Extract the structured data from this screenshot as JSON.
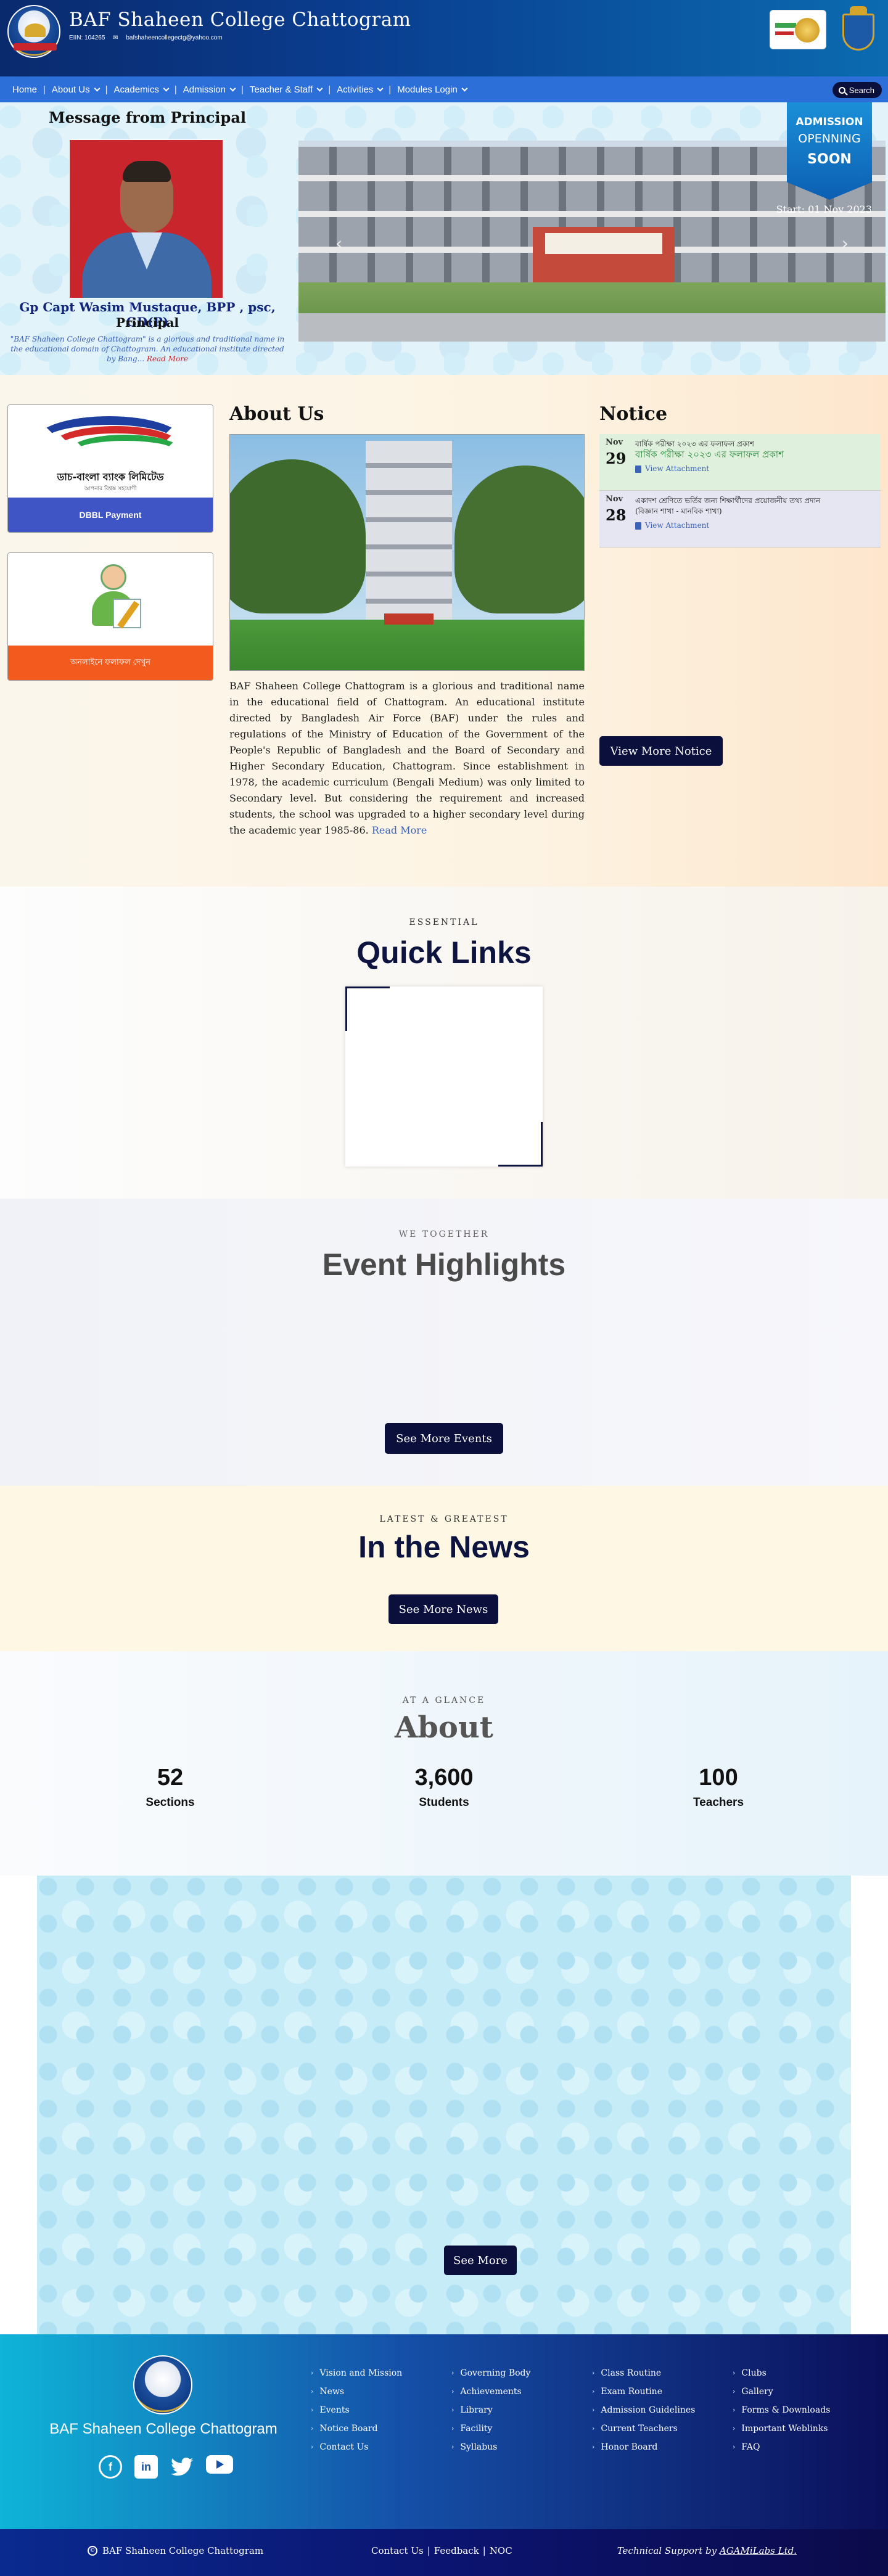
{
  "header": {
    "title": "BAF Shaheen College Chattogram",
    "eiin": "EIIN: 104265",
    "email": "bafshaheencollegectg@yahoo.com"
  },
  "nav": {
    "items": [
      {
        "label": "Home",
        "dropdown": false
      },
      {
        "label": "About Us",
        "dropdown": true
      },
      {
        "label": "Academics",
        "dropdown": true
      },
      {
        "label": "Admission",
        "dropdown": true
      },
      {
        "label": "Teacher & Staff",
        "dropdown": true
      },
      {
        "label": "Activities",
        "dropdown": true
      },
      {
        "label": "Modules Login",
        "dropdown": true
      }
    ],
    "search_label": "Search"
  },
  "principal": {
    "heading": "Message from Principal",
    "name": "Gp Capt Wasim Mustaque, BPP , psc, GD(P)",
    "role": "Principal",
    "quote": "\"BAF Shaheen College Chattogram\" is a glorious and traditional name in the educational domain of Chattogram. An educational institute directed by Bang...",
    "read_more": "Read More"
  },
  "slider": {
    "caption": "Start: 01 Nov 2023",
    "badge_line1": "ADMISSION",
    "badge_line2": "OPENNING",
    "badge_line3": "SOON"
  },
  "cards": {
    "dbbl_logo_text": "ডাচ-বাংলা ব্যাংক লিমিটেড",
    "dbbl_logo_sub": "আপনার বিশ্বস্ত সহযোগী",
    "dbbl_caption": "DBBL Payment",
    "result_caption": "অনলাইনে ফলাফল দেখুন"
  },
  "about": {
    "heading": "About Us",
    "text": "BAF Shaheen College Chattogram is a glorious and traditional name in the educational field of Chattogram. An educational institute directed by Bangladesh Air Force (BAF) under the rules and regulations of the Ministry of Education of the Government of the People's Republic of Bangladesh and the Board of Secondary and Higher Secondary Education, Chattogram. Since establishment in 1978, the academic curriculum (Bengali Medium) was only limited to Secondary level. But considering the requirement and increased students, the school was upgraded to a higher secondary level during the academic year 1985-86.",
    "read_more": "Read More"
  },
  "notice": {
    "heading": "Notice",
    "items": [
      {
        "month": "Nov",
        "day": "29",
        "line1": "বার্ষিক পরীক্ষা ২০২৩ এর ফলাফল প্রকাশ",
        "line2": "বার্ষিক পরীক্ষা ২০২৩ এর ফলাফল প্রকাশ",
        "attach": "View Attachment"
      },
      {
        "month": "Nov",
        "day": "28",
        "line1": "একাদশ শ্রেণিতে ভর্তির জন্য শিক্ষার্থীদের প্রয়োজনীয় তথ্য প্রদান",
        "line2": "(বিজ্ঞান শাখা - মানবিক শাখা)",
        "attach": "View Attachment"
      }
    ],
    "view_more": "View More Notice"
  },
  "quick_links": {
    "eyebrow": "ESSENTIAL",
    "title": "Quick Links"
  },
  "events": {
    "eyebrow": "WE TOGETHER",
    "title": "Event Highlights",
    "button": "See More Events"
  },
  "news": {
    "eyebrow": "LATEST & GREATEST",
    "title": "In the News",
    "button": "See More News"
  },
  "stats": {
    "eyebrow": "AT A GLANCE",
    "title": "About",
    "items": [
      {
        "value": "52",
        "label": "Sections"
      },
      {
        "value": "3,600",
        "label": "Students"
      },
      {
        "value": "100",
        "label": "Teachers"
      }
    ]
  },
  "gallery": {
    "button": "See More"
  },
  "footer": {
    "name": "BAF Shaheen College Chattogram",
    "col1": [
      "Vision and Mission",
      "News",
      "Events",
      "Notice Board",
      "Contact Us"
    ],
    "col2": [
      "Governing Body",
      "Achievements",
      "Library",
      "Facility",
      "Syllabus"
    ],
    "col3": [
      "Class Routine",
      "Exam Routine",
      "Admission Guidelines",
      "Current Teachers",
      "Honor Board"
    ],
    "col4": [
      "Clubs",
      "Gallery",
      "Forms & Downloads",
      "Important Weblinks",
      "FAQ"
    ],
    "socials": [
      "facebook-icon",
      "linkedin-icon",
      "twitter-icon",
      "youtube-icon"
    ],
    "copyright": "BAF Shaheen College Chattogram",
    "mid_links": [
      "Contact Us",
      "Feedback",
      "NOC"
    ],
    "tech_support": "Technical Support by",
    "tech_company": "AGAMiLabs Ltd."
  }
}
